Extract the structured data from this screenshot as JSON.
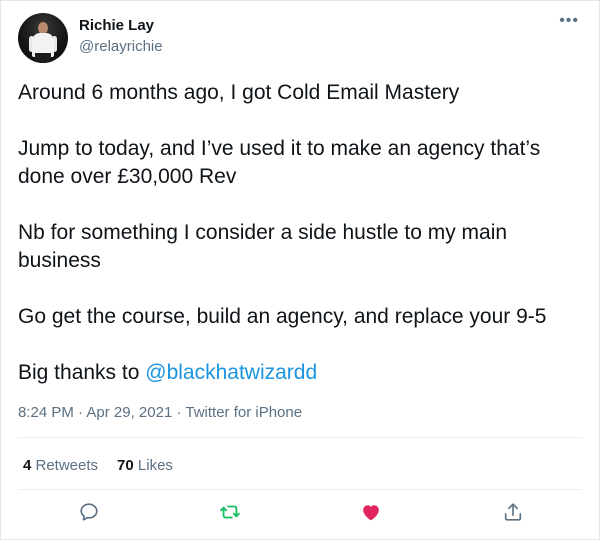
{
  "author": {
    "display_name": "Richie Lay",
    "handle": "@relayrichie"
  },
  "more_menu": "•••",
  "tweet": {
    "paragraphs": [
      "Around 6 months ago, I got Cold Email Mastery",
      "Jump to today, and I’ve used it to make an agency that’s done over £30,000 Rev",
      "Nb for something I consider a side hustle to my main business",
      "Go get the course, build an agency, and replace your 9-5"
    ],
    "last_line_prefix": "Big thanks to ",
    "mention": "@blackhatwizardd"
  },
  "meta": {
    "time": "8:24 PM",
    "separator": " · ",
    "date": "Apr 29, 2021",
    "source": "Twitter for iPhone"
  },
  "stats": {
    "retweets_count": "4",
    "retweets_label": " Retweets",
    "likes_count": "70",
    "likes_label": " Likes"
  },
  "actions": {
    "reply_icon": "reply-icon",
    "retweet_icon": "retweet-icon",
    "like_icon": "heart-icon",
    "share_icon": "share-icon"
  },
  "colors": {
    "link": "#1b95e0",
    "secondary_text": "#5b7083",
    "retweet_green": "#17bf63",
    "like_red": "#e0245e"
  }
}
